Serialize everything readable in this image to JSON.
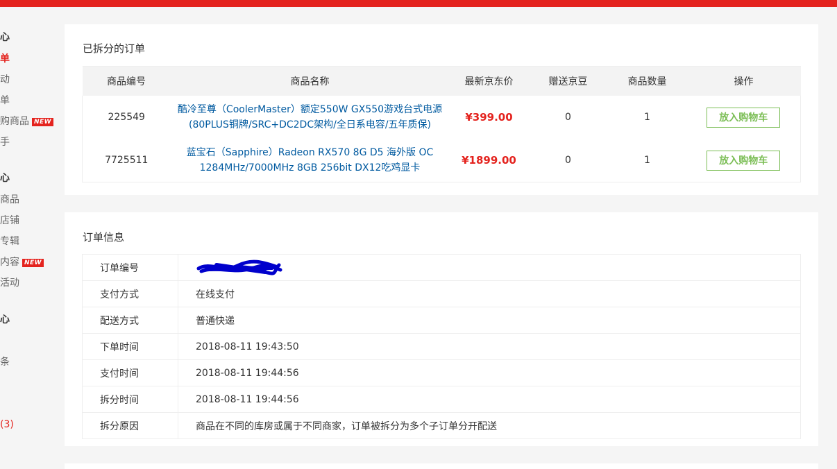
{
  "sidebar": {
    "items": [
      {
        "label": "心",
        "style": "head"
      },
      {
        "label": "单",
        "style": "active"
      },
      {
        "label": "动",
        "style": ""
      },
      {
        "label": "单",
        "style": ""
      },
      {
        "label": "购商品",
        "style": "",
        "badge": "NEW"
      },
      {
        "label": "手",
        "style": ""
      },
      {
        "label": "心",
        "style": "head"
      },
      {
        "label": "商品",
        "style": ""
      },
      {
        "label": "店铺",
        "style": ""
      },
      {
        "label": "专辑",
        "style": ""
      },
      {
        "label": "内容",
        "style": "",
        "badge": "NEW"
      },
      {
        "label": "活动",
        "style": ""
      },
      {
        "label": "心",
        "style": "head"
      },
      {
        "label": "条",
        "style": ""
      },
      {
        "label": "(3)",
        "style": "red"
      }
    ]
  },
  "split_orders": {
    "title": "已拆分的订单",
    "headers": [
      "商品编号",
      "商品名称",
      "最新京东价",
      "赠送京豆",
      "商品数量",
      "操作"
    ],
    "rows": [
      {
        "id": "225549",
        "name_line1": "酷冷至尊（CoolerMaster）额定550W GX550游戏台式电源",
        "name_line2": "(80PLUS铜牌/SRC+DC2DC架构/全日系电容/五年质保)",
        "price": "¥399.00",
        "beans": "0",
        "qty": "1",
        "action": "放入购物车"
      },
      {
        "id": "7725511",
        "name_line1": "蓝宝石（Sapphire）Radeon RX570 8G D5 海外版 OC",
        "name_line2": "1284MHz/7000MHz 8GB 256bit DX12吃鸡显卡",
        "price": "¥1899.00",
        "beans": "0",
        "qty": "1",
        "action": "放入购物车"
      }
    ]
  },
  "order_info": {
    "title": "订单信息",
    "rows": [
      {
        "key": "订单编号",
        "value": ""
      },
      {
        "key": "支付方式",
        "value": "在线支付"
      },
      {
        "key": "配送方式",
        "value": "普通快递"
      },
      {
        "key": "下单时间",
        "value": "2018-08-11 19:43:50"
      },
      {
        "key": "支付时间",
        "value": "2018-08-11 19:44:56"
      },
      {
        "key": "拆分时间",
        "value": "2018-08-11 19:44:56"
      },
      {
        "key": "拆分原因",
        "value": "商品在不同的库房或属于不同商家，订单被拆分为多个子订单分开配送"
      }
    ]
  },
  "colors": {
    "brand_red": "#e4231e",
    "link_blue": "#005aa0",
    "button_green": "#7abd54",
    "scribble_blue": "#0000cc"
  }
}
